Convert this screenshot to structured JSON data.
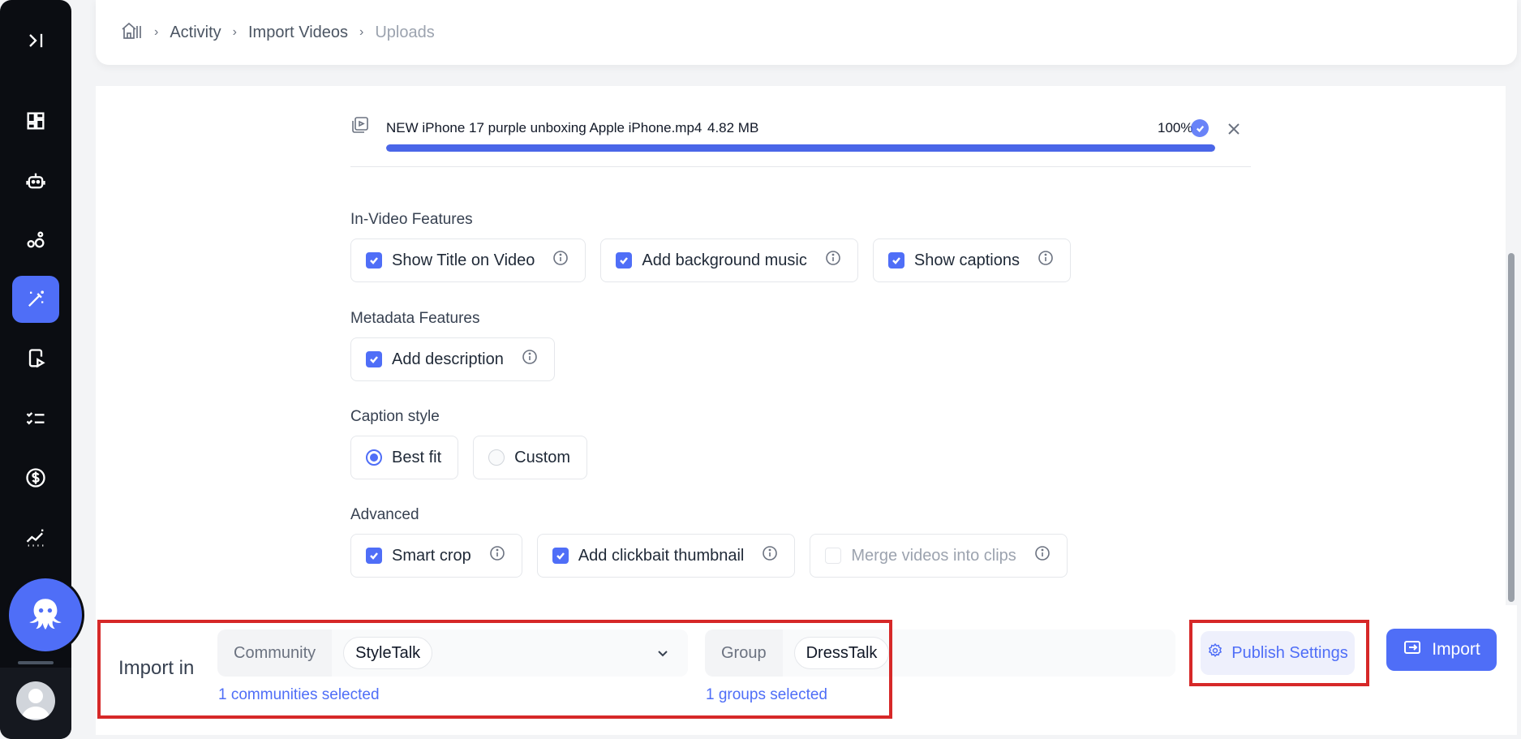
{
  "sidebar": {
    "items": [
      {
        "icon": "collapse-icon"
      },
      {
        "icon": "dashboard-icon"
      },
      {
        "icon": "robot-icon"
      },
      {
        "icon": "bubbles-icon"
      },
      {
        "icon": "magic-wand-icon",
        "active": true
      },
      {
        "icon": "mobile-video-icon"
      },
      {
        "icon": "checklist-icon"
      },
      {
        "icon": "dollar-icon"
      },
      {
        "icon": "analytics-icon"
      }
    ],
    "mascot_icon": "octopus-icon",
    "avatar_icon": "user-avatar-icon"
  },
  "breadcrumb": {
    "home_icon": "home-icon",
    "items": [
      "Activity",
      "Import Videos",
      "Uploads"
    ]
  },
  "upload": {
    "file_name": "NEW iPhone 17 purple unboxing Apple iPhone.mp4",
    "file_size": "4.82 MB",
    "progress_label": "100%",
    "progress": 1.0
  },
  "sections": {
    "in_video": {
      "title": "In-Video Features",
      "options": [
        {
          "label": "Show Title on Video",
          "checked": true
        },
        {
          "label": "Add background music",
          "checked": true
        },
        {
          "label": "Show captions",
          "checked": true
        }
      ]
    },
    "metadata": {
      "title": "Metadata Features",
      "options": [
        {
          "label": "Add description",
          "checked": true
        }
      ]
    },
    "caption_style": {
      "title": "Caption style",
      "options": [
        {
          "label": "Best fit",
          "selected": true
        },
        {
          "label": "Custom",
          "selected": false
        }
      ]
    },
    "advanced": {
      "title": "Advanced",
      "options": [
        {
          "label": "Smart crop",
          "checked": true
        },
        {
          "label": "Add clickbait thumbnail",
          "checked": true
        },
        {
          "label": "Merge videos into clips",
          "checked": false,
          "disabled": true
        }
      ]
    }
  },
  "import_bar": {
    "label": "Import in",
    "community": {
      "label": "Community",
      "value": "StyleTalk",
      "selected_text": "1 communities selected"
    },
    "group": {
      "label": "Group",
      "value": "DressTalk",
      "selected_text": "1 groups selected"
    },
    "publish_settings": "Publish Settings",
    "import": "Import"
  },
  "colors": {
    "accent": "#4f6ef7",
    "sidebar_bg": "#0b0d12",
    "highlight": "#d62828"
  }
}
